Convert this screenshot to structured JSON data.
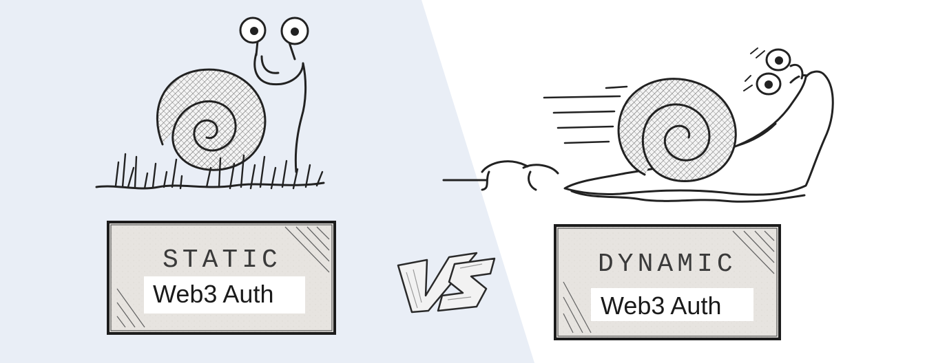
{
  "static": {
    "sign_text": "STATIC",
    "label": "Web3 Auth"
  },
  "dynamic": {
    "sign_text": "DYNAMIC",
    "label": "Web3 Auth"
  },
  "versus_text": "VS",
  "colors": {
    "left_background": "#e9eef6",
    "right_background": "#ffffff",
    "ink": "#222222",
    "sign_fill": "#e6e3df"
  }
}
